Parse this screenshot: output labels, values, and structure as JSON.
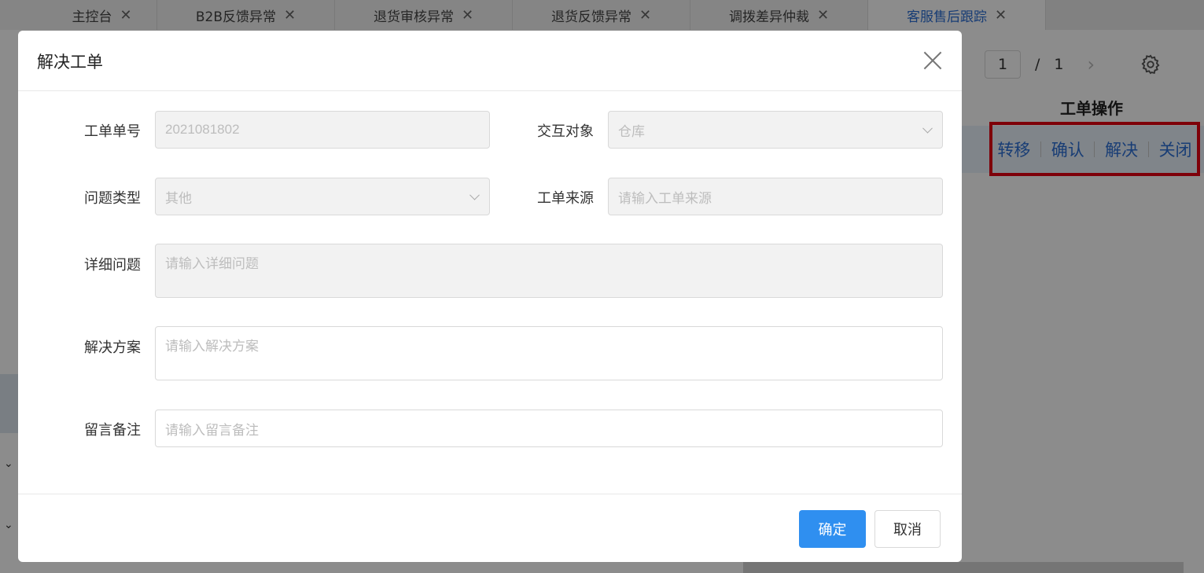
{
  "tabs": [
    {
      "label": "主控台",
      "active": false
    },
    {
      "label": "B2B反馈异常",
      "active": false
    },
    {
      "label": "退货审核异常",
      "active": false
    },
    {
      "label": "退货反馈异常",
      "active": false
    },
    {
      "label": "调拨差异仲裁",
      "active": false
    },
    {
      "label": "客服售后跟踪",
      "active": true
    }
  ],
  "tab_close_glyph": "✕",
  "pager": {
    "current": "1",
    "separator": "/",
    "total": "1",
    "next": "›"
  },
  "table": {
    "column_header": "工单操作",
    "row_actions": [
      "转移",
      "确认",
      "解决",
      "关闭"
    ]
  },
  "modal": {
    "title": "解决工单",
    "fields": {
      "order_no": {
        "label": "工单单号",
        "value": "2021081802"
      },
      "interaction_target": {
        "label": "交互对象",
        "value": "仓库"
      },
      "issue_type": {
        "label": "问题类型",
        "value": "其他"
      },
      "order_source": {
        "label": "工单来源",
        "placeholder": "请输入工单来源"
      },
      "detail_issue": {
        "label": "详细问题",
        "placeholder": "请输入详细问题"
      },
      "solution": {
        "label": "解决方案",
        "placeholder": "请输入解决方案"
      },
      "remark": {
        "label": "留言备注",
        "placeholder": "请输入留言备注"
      }
    },
    "confirm_label": "确定",
    "cancel_label": "取消"
  },
  "colors": {
    "primary": "#2f8ff0",
    "link": "#2d6fd6",
    "highlight_box": "#e60012"
  }
}
